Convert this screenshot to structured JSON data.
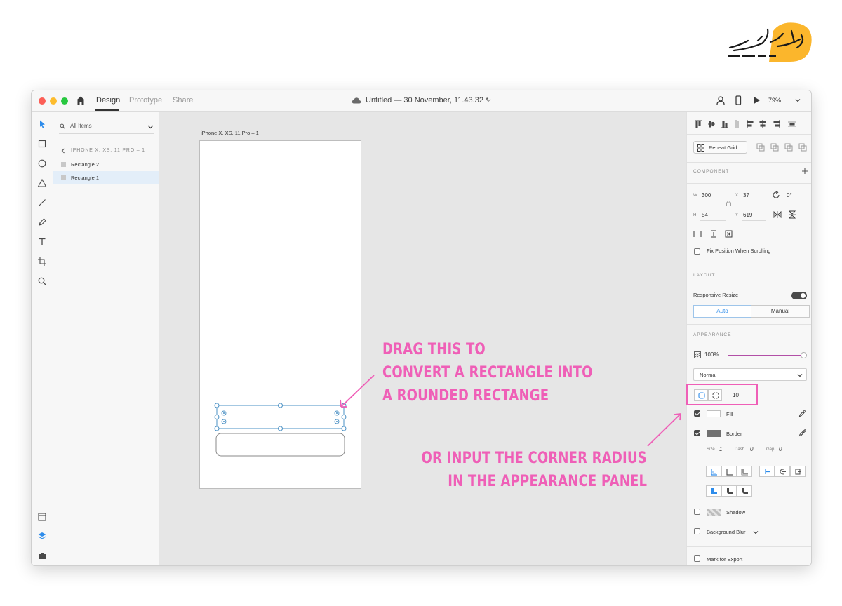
{
  "logo": {
    "text": "لوگوی تحریری"
  },
  "titlebar": {
    "tabs": [
      "Design",
      "Prototype",
      "Share"
    ],
    "active_tab": "Design",
    "document_title": "Untitled — 30 November, 11.43.32 *",
    "zoom": "79%"
  },
  "layers": {
    "search_placeholder": "All Items",
    "breadcrumb": "IPHONE X, XS, 11 PRO – 1",
    "items": [
      {
        "label": "Rectangle 2"
      },
      {
        "label": "Rectangle 1"
      }
    ],
    "selected": "Rectangle 1"
  },
  "canvas": {
    "artboard_label": "iPhone X, XS, 11 Pro – 1"
  },
  "inspector": {
    "repeat_grid_label": "Repeat Grid",
    "component_title": "COMPONENT",
    "w_label": "W",
    "w_value": "300",
    "h_label": "H",
    "h_value": "54",
    "x_label": "X",
    "x_value": "37",
    "y_label": "Y",
    "y_value": "619",
    "rotation": "0°",
    "fix_position_label": "Fix Position When Scrolling",
    "layout_title": "LAYOUT",
    "responsive_resize_label": "Responsive Resize",
    "responsive_resize_on": true,
    "resize_modes": [
      "Auto",
      "Manual"
    ],
    "active_resize_mode": "Auto",
    "appearance_title": "APPEARANCE",
    "opacity": "100%",
    "blend_mode": "Normal",
    "corner_radius": "10",
    "fill_label": "Fill",
    "fill_checked": true,
    "fill_color": "#ffffff",
    "border_label": "Border",
    "border_checked": true,
    "border_color": "#707070",
    "size_label": "Size",
    "size_value": "1",
    "dash_label": "Dash",
    "dash_value": "0",
    "gap_label": "Gap",
    "gap_value": "0",
    "shadow_label": "Shadow",
    "background_blur_label": "Background Blur",
    "mark_export_label": "Mark for Export"
  },
  "annotations": {
    "drag_note": [
      "DRAG THIS TO",
      "CONVERT A RECTANGLE INTO",
      "A ROUNDED RECTANGE"
    ],
    "input_note": [
      "OR INPUT THE CORNER RADIUS",
      "IN THE APPEARANCE PANEL"
    ],
    "color": "#ef5fb7"
  },
  "colors": {
    "accent": "#2d8ceb",
    "selection": "#4a90c4",
    "slider": "#b24fa7"
  }
}
